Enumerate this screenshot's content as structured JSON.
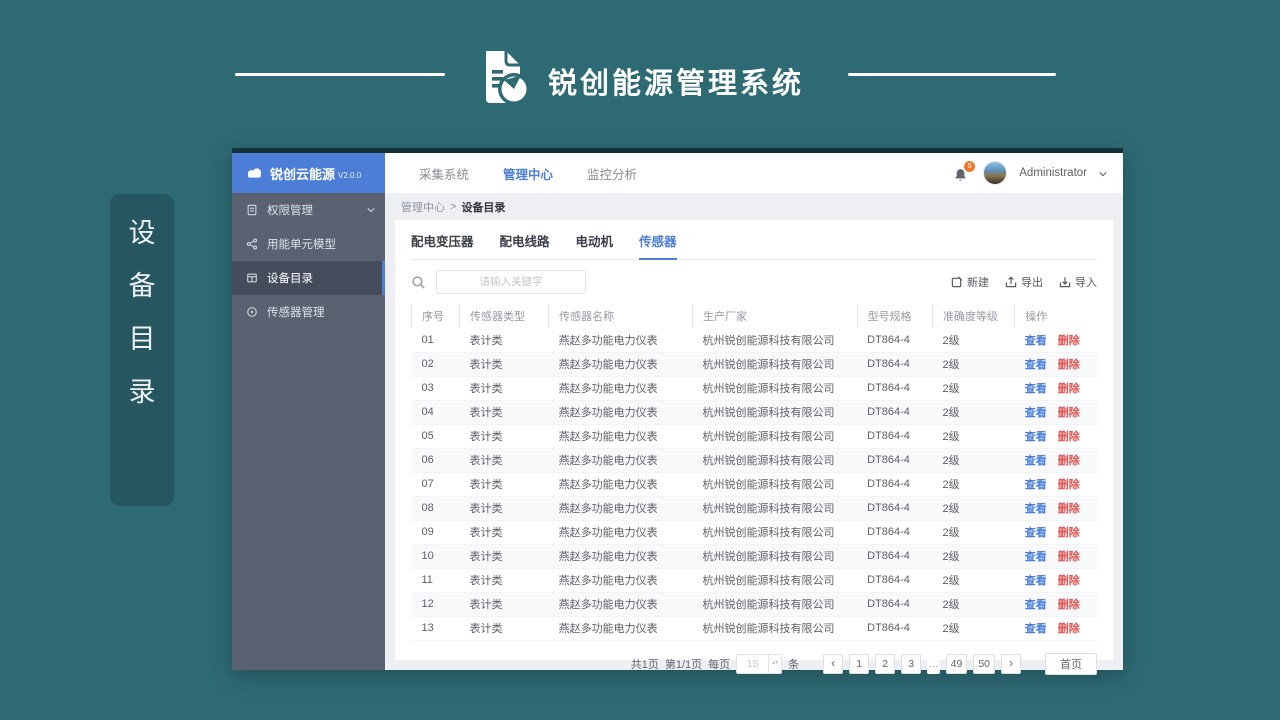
{
  "banner": {
    "title": "锐创能源管理系统",
    "logo_icon": "document-chart-icon"
  },
  "side_tag": {
    "text": "设备目录",
    "chars": [
      "设",
      "备",
      "目",
      "录"
    ]
  },
  "app": {
    "sidebar": {
      "product": "锐创云能源",
      "version": "V2.0.0",
      "logo_icon": "cloud-icon",
      "items": [
        {
          "label": "权限管理",
          "icon": "permissions-icon",
          "active": false,
          "expandable": true
        },
        {
          "label": "用能单元模型",
          "icon": "energy-unit-model-icon",
          "active": false
        },
        {
          "label": "设备目录",
          "icon": "device-catalog-icon",
          "active": true
        },
        {
          "label": "传感器管理",
          "icon": "sensor-management-icon",
          "active": false
        }
      ]
    },
    "topnav": {
      "items": [
        {
          "label": "采集系统",
          "active": false
        },
        {
          "label": "管理中心",
          "active": true
        },
        {
          "label": "监控分析",
          "active": false
        }
      ],
      "notification_count": "5",
      "user": "Administrator"
    },
    "breadcrumb": {
      "parent": "管理中心",
      "separator": ">",
      "current": "设备目录"
    },
    "tabs": [
      {
        "label": "配电变压器",
        "active": false
      },
      {
        "label": "配电线路",
        "active": false
      },
      {
        "label": "电动机",
        "active": false
      },
      {
        "label": "传感器",
        "active": true
      }
    ],
    "toolbar": {
      "search_placeholder": "请输入关键字",
      "new_label": "新建",
      "export_label": "导出",
      "import_label": "导入"
    },
    "table": {
      "columns": [
        "序号",
        "传感器类型",
        "传感器名称",
        "生产厂家",
        "型号规格",
        "准确度等级",
        "操作"
      ],
      "actions": {
        "view": "查看",
        "remove": "删除"
      },
      "rows": [
        {
          "no": "01",
          "type": "表计类",
          "name": "燕赵多功能电力仪表",
          "maker": "杭州锐创能源科技有限公司",
          "model": "DT864-4",
          "accuracy": "2级"
        },
        {
          "no": "02",
          "type": "表计类",
          "name": "燕赵多功能电力仪表",
          "maker": "杭州锐创能源科技有限公司",
          "model": "DT864-4",
          "accuracy": "2级"
        },
        {
          "no": "03",
          "type": "表计类",
          "name": "燕赵多功能电力仪表",
          "maker": "杭州锐创能源科技有限公司",
          "model": "DT864-4",
          "accuracy": "2级"
        },
        {
          "no": "04",
          "type": "表计类",
          "name": "燕赵多功能电力仪表",
          "maker": "杭州锐创能源科技有限公司",
          "model": "DT864-4",
          "accuracy": "2级"
        },
        {
          "no": "05",
          "type": "表计类",
          "name": "燕赵多功能电力仪表",
          "maker": "杭州锐创能源科技有限公司",
          "model": "DT864-4",
          "accuracy": "2级"
        },
        {
          "no": "06",
          "type": "表计类",
          "name": "燕赵多功能电力仪表",
          "maker": "杭州锐创能源科技有限公司",
          "model": "DT864-4",
          "accuracy": "2级"
        },
        {
          "no": "07",
          "type": "表计类",
          "name": "燕赵多功能电力仪表",
          "maker": "杭州锐创能源科技有限公司",
          "model": "DT864-4",
          "accuracy": "2级"
        },
        {
          "no": "08",
          "type": "表计类",
          "name": "燕赵多功能电力仪表",
          "maker": "杭州锐创能源科技有限公司",
          "model": "DT864-4",
          "accuracy": "2级"
        },
        {
          "no": "09",
          "type": "表计类",
          "name": "燕赵多功能电力仪表",
          "maker": "杭州锐创能源科技有限公司",
          "model": "DT864-4",
          "accuracy": "2级"
        },
        {
          "no": "10",
          "type": "表计类",
          "name": "燕赵多功能电力仪表",
          "maker": "杭州锐创能源科技有限公司",
          "model": "DT864-4",
          "accuracy": "2级"
        },
        {
          "no": "11",
          "type": "表计类",
          "name": "燕赵多功能电力仪表",
          "maker": "杭州锐创能源科技有限公司",
          "model": "DT864-4",
          "accuracy": "2级"
        },
        {
          "no": "12",
          "type": "表计类",
          "name": "燕赵多功能电力仪表",
          "maker": "杭州锐创能源科技有限公司",
          "model": "DT864-4",
          "accuracy": "2级"
        },
        {
          "no": "13",
          "type": "表计类",
          "name": "燕赵多功能电力仪表",
          "maker": "杭州锐创能源科技有限公司",
          "model": "DT864-4",
          "accuracy": "2级"
        }
      ]
    },
    "pagination": {
      "total_text": "共1页",
      "page_text": "第1/1页",
      "per_page_label": "每页",
      "per_page_value": "15",
      "unit_label": "条",
      "prev": "‹",
      "next": "›",
      "pages": [
        {
          "label": "1"
        },
        {
          "label": "2"
        },
        {
          "label": "3"
        },
        {
          "label": "…",
          "is_ellipsis": true
        },
        {
          "label": "49"
        },
        {
          "label": "50"
        }
      ],
      "home_label": "首页"
    }
  },
  "colors": {
    "page_background": "#2e6a74",
    "accent_blue": "#4c7ed7",
    "danger_red": "#e05252",
    "sidebar_gray": "#5a6171",
    "badge_orange": "#ed7b2f"
  }
}
